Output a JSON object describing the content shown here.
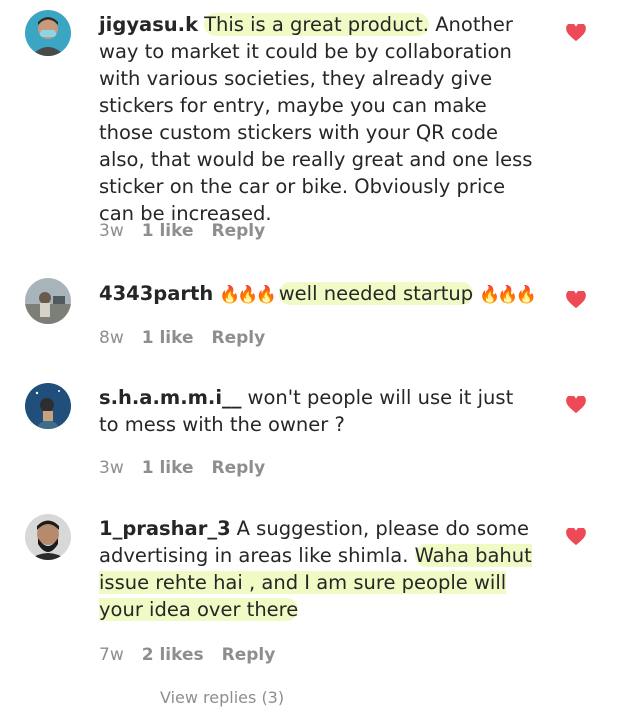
{
  "comments": [
    {
      "username": "jigyasu.k",
      "text_highlight": "This is a great product.",
      "text_rest": " Another way to market it could be by collaboration with various societies, they already give stickers for entry, maybe you can make those custom stickers with your QR code also, that would be really great and one less sticker on the car or bike. Obviously price can be increased.",
      "time": "3w",
      "likes": "1 like",
      "reply": "Reply",
      "avatar_icon": "user-avatar-masked"
    },
    {
      "username": "4343parth",
      "flames_before": "🔥🔥🔥",
      "text_highlight": "well needed startup",
      "flames_after": "🔥🔥🔥",
      "time": "8w",
      "likes": "1 like",
      "reply": "Reply",
      "avatar_icon": "user-avatar-outdoor"
    },
    {
      "username": "s.h.a.m.m.i__",
      "text": "won't people will use it just to mess with the owner ?",
      "time": "3w",
      "likes": "1 like",
      "reply": "Reply",
      "avatar_icon": "user-avatar-night"
    },
    {
      "username": "1_prashar_3",
      "text_start": "A suggestion, please do some advertising in areas like shimla.",
      "text_highlight": "Waha bahut issue rehte hai , and I am sure people will your idea over there",
      "time": "7w",
      "likes": "2 likes",
      "reply": "Reply",
      "avatar_icon": "user-avatar-bearded"
    }
  ],
  "view_more": "View replies (3)",
  "colors": {
    "heart": "#ed4956",
    "highlight": "#e2f596",
    "meta": "#8e8e8e",
    "text": "#262626"
  }
}
